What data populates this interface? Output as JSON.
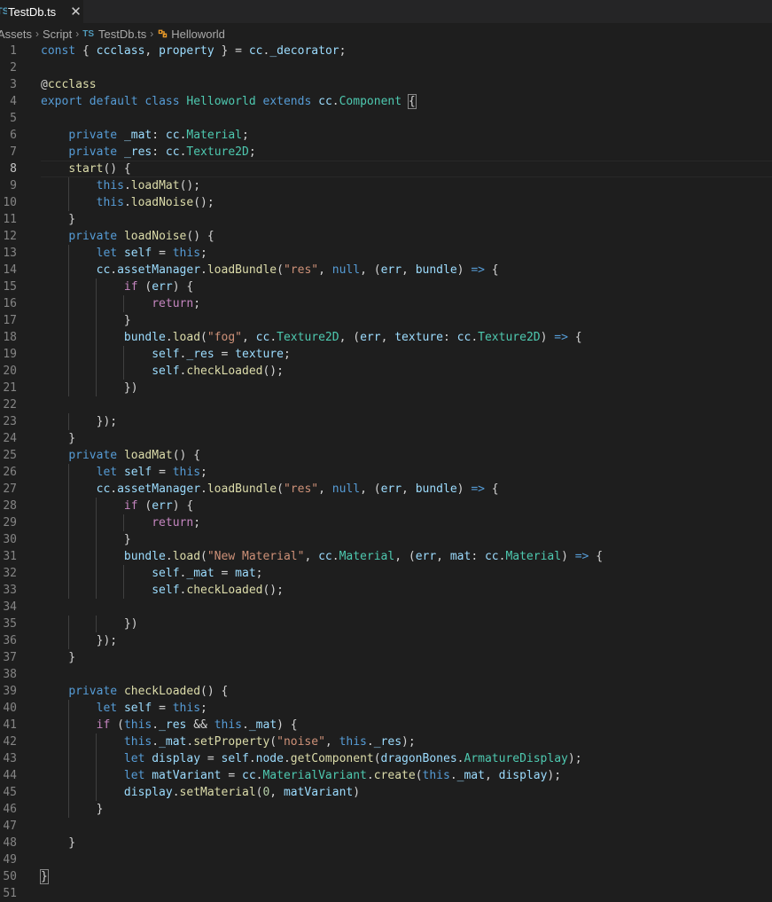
{
  "tab": {
    "icon": "TS",
    "title": "TestDb.ts",
    "close": "✕"
  },
  "breadcrumb": {
    "items": [
      "Assets",
      "Script",
      "TestDb.ts",
      "Helloworld"
    ],
    "separator": "›",
    "file_icon": "TS",
    "symbol_icon": "class-symbol-icon"
  },
  "editor": {
    "current_line": 8,
    "line_numbers": [
      "1",
      "2",
      "3",
      "4",
      "5",
      "6",
      "7",
      "8",
      "9",
      "10",
      "11",
      "12",
      "13",
      "14",
      "15",
      "16",
      "17",
      "18",
      "19",
      "20",
      "21",
      "22",
      "23",
      "24",
      "25",
      "26",
      "27",
      "28",
      "29",
      "30",
      "31",
      "32",
      "33",
      "34",
      "35",
      "36",
      "37",
      "38",
      "39",
      "40",
      "41",
      "42",
      "43",
      "44",
      "45",
      "46",
      "47",
      "48",
      "49",
      "50",
      "51"
    ],
    "lines": [
      [
        [
          "kw",
          "const"
        ],
        [
          "p",
          " { "
        ],
        [
          "var",
          "ccclass"
        ],
        [
          "p",
          ", "
        ],
        [
          "var",
          "property"
        ],
        [
          "p",
          " } = "
        ],
        [
          "var",
          "cc"
        ],
        [
          "p",
          "."
        ],
        [
          "var",
          "_decorator"
        ],
        [
          "p",
          ";"
        ]
      ],
      [],
      [
        [
          "p",
          "@"
        ],
        [
          "fn",
          "ccclass"
        ]
      ],
      [
        [
          "kw",
          "export"
        ],
        [
          "p",
          " "
        ],
        [
          "kw",
          "default"
        ],
        [
          "p",
          " "
        ],
        [
          "kw",
          "class"
        ],
        [
          "p",
          " "
        ],
        [
          "ty",
          "Helloworld"
        ],
        [
          "p",
          " "
        ],
        [
          "kw",
          "extends"
        ],
        [
          "p",
          " "
        ],
        [
          "var",
          "cc"
        ],
        [
          "p",
          "."
        ],
        [
          "ty",
          "Component"
        ],
        [
          "p",
          " "
        ],
        [
          "bh",
          "{"
        ]
      ],
      [],
      [
        [
          "p",
          "    "
        ],
        [
          "kw",
          "private"
        ],
        [
          "p",
          " "
        ],
        [
          "var",
          "_mat"
        ],
        [
          "p",
          ": "
        ],
        [
          "var",
          "cc"
        ],
        [
          "p",
          "."
        ],
        [
          "ty",
          "Material"
        ],
        [
          "p",
          ";"
        ]
      ],
      [
        [
          "p",
          "    "
        ],
        [
          "kw",
          "private"
        ],
        [
          "p",
          " "
        ],
        [
          "var",
          "_res"
        ],
        [
          "p",
          ": "
        ],
        [
          "var",
          "cc"
        ],
        [
          "p",
          "."
        ],
        [
          "ty",
          "Texture2D"
        ],
        [
          "p",
          ";"
        ]
      ],
      [
        [
          "p",
          "    "
        ],
        [
          "fn",
          "start"
        ],
        [
          "p",
          "() {"
        ]
      ],
      [
        [
          "p",
          "        "
        ],
        [
          "kw",
          "this"
        ],
        [
          "p",
          "."
        ],
        [
          "fn",
          "loadMat"
        ],
        [
          "p",
          "();"
        ]
      ],
      [
        [
          "p",
          "        "
        ],
        [
          "kw",
          "this"
        ],
        [
          "p",
          "."
        ],
        [
          "fn",
          "loadNoise"
        ],
        [
          "p",
          "();"
        ]
      ],
      [
        [
          "p",
          "    }"
        ]
      ],
      [
        [
          "p",
          "    "
        ],
        [
          "kw",
          "private"
        ],
        [
          "p",
          " "
        ],
        [
          "fn",
          "loadNoise"
        ],
        [
          "p",
          "() {"
        ]
      ],
      [
        [
          "p",
          "        "
        ],
        [
          "kw",
          "let"
        ],
        [
          "p",
          " "
        ],
        [
          "var",
          "self"
        ],
        [
          "p",
          " = "
        ],
        [
          "kw",
          "this"
        ],
        [
          "p",
          ";"
        ]
      ],
      [
        [
          "p",
          "        "
        ],
        [
          "var",
          "cc"
        ],
        [
          "p",
          "."
        ],
        [
          "var",
          "assetManager"
        ],
        [
          "p",
          "."
        ],
        [
          "fn",
          "loadBundle"
        ],
        [
          "p",
          "("
        ],
        [
          "str",
          "\"res\""
        ],
        [
          "p",
          ", "
        ],
        [
          "kw",
          "null"
        ],
        [
          "p",
          ", ("
        ],
        [
          "var",
          "err"
        ],
        [
          "p",
          ", "
        ],
        [
          "var",
          "bundle"
        ],
        [
          "p",
          ") "
        ],
        [
          "kw",
          "=>"
        ],
        [
          "p",
          " {"
        ]
      ],
      [
        [
          "p",
          "            "
        ],
        [
          "ctl",
          "if"
        ],
        [
          "p",
          " ("
        ],
        [
          "var",
          "err"
        ],
        [
          "p",
          ") {"
        ]
      ],
      [
        [
          "p",
          "                "
        ],
        [
          "ctl",
          "return"
        ],
        [
          "p",
          ";"
        ]
      ],
      [
        [
          "p",
          "            }"
        ]
      ],
      [
        [
          "p",
          "            "
        ],
        [
          "var",
          "bundle"
        ],
        [
          "p",
          "."
        ],
        [
          "fn",
          "load"
        ],
        [
          "p",
          "("
        ],
        [
          "str",
          "\"fog\""
        ],
        [
          "p",
          ", "
        ],
        [
          "var",
          "cc"
        ],
        [
          "p",
          "."
        ],
        [
          "ty",
          "Texture2D"
        ],
        [
          "p",
          ", ("
        ],
        [
          "var",
          "err"
        ],
        [
          "p",
          ", "
        ],
        [
          "var",
          "texture"
        ],
        [
          "p",
          ": "
        ],
        [
          "var",
          "cc"
        ],
        [
          "p",
          "."
        ],
        [
          "ty",
          "Texture2D"
        ],
        [
          "p",
          ") "
        ],
        [
          "kw",
          "=>"
        ],
        [
          "p",
          " {"
        ]
      ],
      [
        [
          "p",
          "                "
        ],
        [
          "var",
          "self"
        ],
        [
          "p",
          "."
        ],
        [
          "var",
          "_res"
        ],
        [
          "p",
          " = "
        ],
        [
          "var",
          "texture"
        ],
        [
          "p",
          ";"
        ]
      ],
      [
        [
          "p",
          "                "
        ],
        [
          "var",
          "self"
        ],
        [
          "p",
          "."
        ],
        [
          "fn",
          "checkLoaded"
        ],
        [
          "p",
          "();"
        ]
      ],
      [
        [
          "p",
          "            })"
        ]
      ],
      [],
      [
        [
          "p",
          "        });"
        ]
      ],
      [
        [
          "p",
          "    }"
        ]
      ],
      [
        [
          "p",
          "    "
        ],
        [
          "kw",
          "private"
        ],
        [
          "p",
          " "
        ],
        [
          "fn",
          "loadMat"
        ],
        [
          "p",
          "() {"
        ]
      ],
      [
        [
          "p",
          "        "
        ],
        [
          "kw",
          "let"
        ],
        [
          "p",
          " "
        ],
        [
          "var",
          "self"
        ],
        [
          "p",
          " = "
        ],
        [
          "kw",
          "this"
        ],
        [
          "p",
          ";"
        ]
      ],
      [
        [
          "p",
          "        "
        ],
        [
          "var",
          "cc"
        ],
        [
          "p",
          "."
        ],
        [
          "var",
          "assetManager"
        ],
        [
          "p",
          "."
        ],
        [
          "fn",
          "loadBundle"
        ],
        [
          "p",
          "("
        ],
        [
          "str",
          "\"res\""
        ],
        [
          "p",
          ", "
        ],
        [
          "kw",
          "null"
        ],
        [
          "p",
          ", ("
        ],
        [
          "var",
          "err"
        ],
        [
          "p",
          ", "
        ],
        [
          "var",
          "bundle"
        ],
        [
          "p",
          ") "
        ],
        [
          "kw",
          "=>"
        ],
        [
          "p",
          " {"
        ]
      ],
      [
        [
          "p",
          "            "
        ],
        [
          "ctl",
          "if"
        ],
        [
          "p",
          " ("
        ],
        [
          "var",
          "err"
        ],
        [
          "p",
          ") {"
        ]
      ],
      [
        [
          "p",
          "                "
        ],
        [
          "ctl",
          "return"
        ],
        [
          "p",
          ";"
        ]
      ],
      [
        [
          "p",
          "            }"
        ]
      ],
      [
        [
          "p",
          "            "
        ],
        [
          "var",
          "bundle"
        ],
        [
          "p",
          "."
        ],
        [
          "fn",
          "load"
        ],
        [
          "p",
          "("
        ],
        [
          "str",
          "\"New Material\""
        ],
        [
          "p",
          ", "
        ],
        [
          "var",
          "cc"
        ],
        [
          "p",
          "."
        ],
        [
          "ty",
          "Material"
        ],
        [
          "p",
          ", ("
        ],
        [
          "var",
          "err"
        ],
        [
          "p",
          ", "
        ],
        [
          "var",
          "mat"
        ],
        [
          "p",
          ": "
        ],
        [
          "var",
          "cc"
        ],
        [
          "p",
          "."
        ],
        [
          "ty",
          "Material"
        ],
        [
          "p",
          ") "
        ],
        [
          "kw",
          "=>"
        ],
        [
          "p",
          " {"
        ]
      ],
      [
        [
          "p",
          "                "
        ],
        [
          "var",
          "self"
        ],
        [
          "p",
          "."
        ],
        [
          "var",
          "_mat"
        ],
        [
          "p",
          " = "
        ],
        [
          "var",
          "mat"
        ],
        [
          "p",
          ";"
        ]
      ],
      [
        [
          "p",
          "                "
        ],
        [
          "var",
          "self"
        ],
        [
          "p",
          "."
        ],
        [
          "fn",
          "checkLoaded"
        ],
        [
          "p",
          "();"
        ]
      ],
      [],
      [
        [
          "p",
          "            })"
        ]
      ],
      [
        [
          "p",
          "        });"
        ]
      ],
      [
        [
          "p",
          "    }"
        ]
      ],
      [],
      [
        [
          "p",
          "    "
        ],
        [
          "kw",
          "private"
        ],
        [
          "p",
          " "
        ],
        [
          "fn",
          "checkLoaded"
        ],
        [
          "p",
          "() {"
        ]
      ],
      [
        [
          "p",
          "        "
        ],
        [
          "kw",
          "let"
        ],
        [
          "p",
          " "
        ],
        [
          "var",
          "self"
        ],
        [
          "p",
          " = "
        ],
        [
          "kw",
          "this"
        ],
        [
          "p",
          ";"
        ]
      ],
      [
        [
          "p",
          "        "
        ],
        [
          "ctl",
          "if"
        ],
        [
          "p",
          " ("
        ],
        [
          "kw",
          "this"
        ],
        [
          "p",
          "."
        ],
        [
          "var",
          "_res"
        ],
        [
          "p",
          " && "
        ],
        [
          "kw",
          "this"
        ],
        [
          "p",
          "."
        ],
        [
          "var",
          "_mat"
        ],
        [
          "p",
          ") {"
        ]
      ],
      [
        [
          "p",
          "            "
        ],
        [
          "kw",
          "this"
        ],
        [
          "p",
          "."
        ],
        [
          "var",
          "_mat"
        ],
        [
          "p",
          "."
        ],
        [
          "fn",
          "setProperty"
        ],
        [
          "p",
          "("
        ],
        [
          "str",
          "\"noise\""
        ],
        [
          "p",
          ", "
        ],
        [
          "kw",
          "this"
        ],
        [
          "p",
          "."
        ],
        [
          "var",
          "_res"
        ],
        [
          "p",
          ");"
        ]
      ],
      [
        [
          "p",
          "            "
        ],
        [
          "kw",
          "let"
        ],
        [
          "p",
          " "
        ],
        [
          "var",
          "display"
        ],
        [
          "p",
          " = "
        ],
        [
          "var",
          "self"
        ],
        [
          "p",
          "."
        ],
        [
          "var",
          "node"
        ],
        [
          "p",
          "."
        ],
        [
          "fn",
          "getComponent"
        ],
        [
          "p",
          "("
        ],
        [
          "var",
          "dragonBones"
        ],
        [
          "p",
          "."
        ],
        [
          "ty",
          "ArmatureDisplay"
        ],
        [
          "p",
          ");"
        ]
      ],
      [
        [
          "p",
          "            "
        ],
        [
          "kw",
          "let"
        ],
        [
          "p",
          " "
        ],
        [
          "var",
          "matVariant"
        ],
        [
          "p",
          " = "
        ],
        [
          "var",
          "cc"
        ],
        [
          "p",
          "."
        ],
        [
          "ty",
          "MaterialVariant"
        ],
        [
          "p",
          "."
        ],
        [
          "fn",
          "create"
        ],
        [
          "p",
          "("
        ],
        [
          "kw",
          "this"
        ],
        [
          "p",
          "."
        ],
        [
          "var",
          "_mat"
        ],
        [
          "p",
          ", "
        ],
        [
          "var",
          "display"
        ],
        [
          "p",
          ");"
        ]
      ],
      [
        [
          "p",
          "            "
        ],
        [
          "var",
          "display"
        ],
        [
          "p",
          "."
        ],
        [
          "fn",
          "setMaterial"
        ],
        [
          "p",
          "("
        ],
        [
          "num",
          "0"
        ],
        [
          "p",
          ", "
        ],
        [
          "var",
          "matVariant"
        ],
        [
          "p",
          ")"
        ]
      ],
      [
        [
          "p",
          "        }"
        ]
      ],
      [],
      [
        [
          "p",
          "    }"
        ]
      ],
      [],
      [
        [
          "bh",
          "}"
        ]
      ],
      []
    ]
  }
}
